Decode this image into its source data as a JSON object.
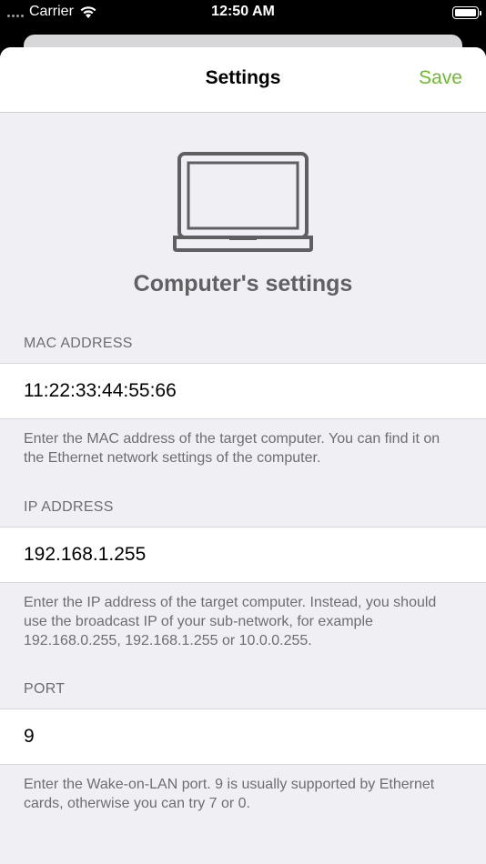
{
  "status_bar": {
    "carrier": "Carrier",
    "time": "12:50 AM"
  },
  "nav": {
    "title": "Settings",
    "save_label": "Save"
  },
  "hero": {
    "title": "Computer's settings"
  },
  "sections": {
    "mac": {
      "header": "MAC ADDRESS",
      "value": "11:22:33:44:55:66",
      "footer": "Enter the MAC address of the target computer. You can find it on the Ethernet network settings of the computer."
    },
    "ip": {
      "header": "IP ADDRESS",
      "value": "192.168.1.255",
      "footer": "Enter the IP address of the target computer. Instead, you should use the broadcast IP of your sub-network, for example 192.168.0.255, 192.168.1.255 or 10.0.0.255."
    },
    "port": {
      "header": "PORT",
      "value": "9",
      "footer": "Enter the Wake-on-LAN port. 9 is usually supported by Ethernet cards, otherwise you can try 7 or 0."
    }
  },
  "colors": {
    "accent": "#6cbc2a",
    "background": "#efeff4",
    "secondary_text": "#6d6d72",
    "hero_text": "#616164"
  },
  "icons": {
    "hero": "laptop-icon",
    "wifi": "wifi-icon",
    "battery": "battery-icon"
  }
}
